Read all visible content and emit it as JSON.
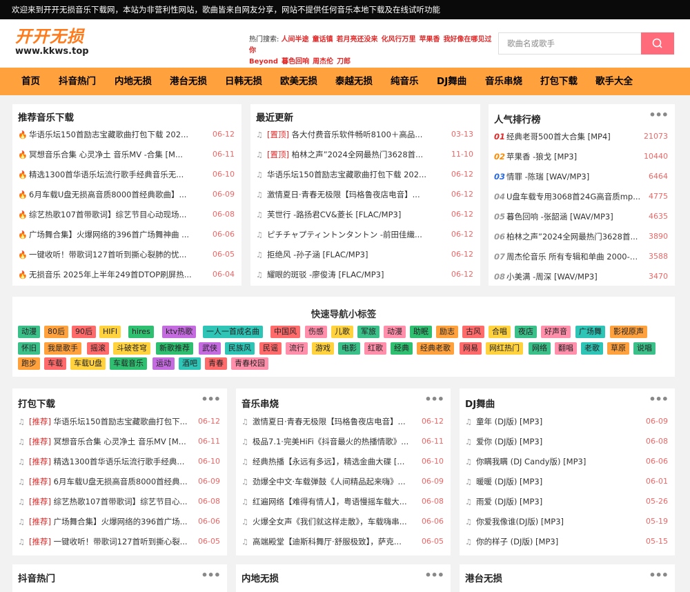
{
  "topbar": {
    "notice": "欢迎来到开开无损音乐下载网，本站为非营利性网站，歌曲皆来自网友分享，网站不提供任何音乐本地下载及在线试听功能"
  },
  "logo": {
    "main": "开开无损",
    "domain": "www.kkws.top"
  },
  "hot": {
    "label": "热门搜索:",
    "items": [
      "人间半途",
      "童话镇",
      "若月亮还没来",
      "化风行万里",
      "苹果香",
      "我好像在哪见过你",
      "Beyond",
      "暮色回响",
      "周杰伦",
      "刀郎"
    ]
  },
  "search": {
    "placeholder": "歌曲名或歌手"
  },
  "nav": [
    "首页",
    "抖音热门",
    "内地无损",
    "港台无损",
    "日韩无损",
    "欧美无损",
    "泰越无损",
    "纯音乐",
    "DJ舞曲",
    "音乐串烧",
    "打包下载",
    "歌手大全"
  ],
  "recommend": {
    "title": "推荐音乐下载",
    "items": [
      {
        "text": "华语乐坛150首励志宝藏歌曲打包下载 202...",
        "date": "06-12"
      },
      {
        "text": "冥想音乐合集 心灵净土 音乐MV -合集 [M...",
        "date": "06-11"
      },
      {
        "text": "精选1300首华语乐坛流行歌手经典音乐无...",
        "date": "06-10"
      },
      {
        "text": "6月车载U盘无损高音质8000首经典歌曲】...",
        "date": "06-09"
      },
      {
        "text": "综艺热歌107首带歌词】综艺节目心动现场...",
        "date": "06-08"
      },
      {
        "text": "广场舞合集】火爆网络的396首广场舞神曲 ...",
        "date": "06-06"
      },
      {
        "text": "一键收听！带歌词127首听到撕心裂肺的忧...",
        "date": "06-05"
      },
      {
        "text": "无损音乐 2025年上半年249首DTOP刷屏热...",
        "date": "06-04"
      }
    ]
  },
  "latest": {
    "title": "最近更新",
    "items": [
      {
        "tag": "[置顶]",
        "text": " 各大付费音乐软件畅听8100＋高品...",
        "date": "03-13"
      },
      {
        "tag": "[置顶]",
        "text": " 柏林之声”2024全网最热门3628首...",
        "date": "11-10"
      },
      {
        "tag": "",
        "text": "华语乐坛150首励志宝藏歌曲打包下载 202...",
        "date": "06-12"
      },
      {
        "tag": "",
        "text": "激情夏日·青春无极限【玛格鲁夜店电音】...",
        "date": "06-12"
      },
      {
        "tag": "",
        "text": "芙世行 -路扬君CV&菱长 [FLAC/MP3]",
        "date": "06-12"
      },
      {
        "tag": "",
        "text": "ピチチャプティントンタントン -前田佳織...",
        "date": "06-12"
      },
      {
        "tag": "",
        "text": "拒绝风 -孙子涵 [FLAC/MP3]",
        "date": "06-12"
      },
      {
        "tag": "",
        "text": "耀眼的斑驳 -廖俊涛 [FLAC/MP3]",
        "date": "06-12"
      }
    ]
  },
  "ranking": {
    "title": "人气排行榜",
    "more": "•••",
    "items": [
      {
        "num": "01",
        "text": "经典老哥500首大合集 [MP4]",
        "count": "21073"
      },
      {
        "num": "02",
        "text": "苹果香 -狼戈 [MP3]",
        "count": "10440"
      },
      {
        "num": "03",
        "text": "情罪 -陈瑞 [WAV/MP3]",
        "count": "6464"
      },
      {
        "num": "04",
        "text": "U盘车载专用3068首24G高音质mp...",
        "count": "4775"
      },
      {
        "num": "05",
        "text": "暮色回响 -张韶涵 [WAV/MP3]",
        "count": "4635"
      },
      {
        "num": "06",
        "text": "柏林之声”2024全网最热门3628首...",
        "count": "3890"
      },
      {
        "num": "07",
        "text": "周杰伦音乐 所有专辑和单曲 2000-2...",
        "count": "3588"
      },
      {
        "num": "08",
        "text": "小美满 -周深 [WAV/MP3]",
        "count": "3470"
      }
    ]
  },
  "quicknav": {
    "title": "快速导航小标签",
    "tags": [
      "动漫",
      "80后",
      "90后",
      "HIFI",
      "hires",
      "ktv热歌",
      "一人一首成名曲",
      "中国风",
      "伤感",
      "儿歌",
      "军旅",
      "动漫",
      "助眠",
      "励志",
      "古风",
      "合唱",
      "夜店",
      "好声音",
      "广场舞",
      "影视原声",
      "怀旧",
      "我是歌手",
      "摇滚",
      "斗破苍穹",
      "新歌推荐",
      "武侠",
      "民族风",
      "民谣",
      "流行",
      "游戏",
      "电影",
      "红歌",
      "经典",
      "经典老歌",
      "网易",
      "网红热门",
      "网络",
      "翻唱",
      "老歌",
      "草原",
      "说唱",
      "跑步",
      "车载",
      "车载U盘",
      "车载音乐",
      "运动",
      "酒吧",
      "青春",
      "青春校园"
    ]
  },
  "pack": {
    "title": "打包下载",
    "more": "•••",
    "items": [
      {
        "tag": "[推荐]",
        "text": " 华语乐坛150首励志宝藏歌曲打包下...",
        "date": "06-12"
      },
      {
        "tag": "[推荐]",
        "text": " 冥想音乐合集 心灵净土 音乐MV [M...",
        "date": "06-11"
      },
      {
        "tag": "[推荐]",
        "text": " 精选1300首华语乐坛流行歌手经典...",
        "date": "06-10"
      },
      {
        "tag": "[推荐]",
        "text": " 6月车载U盘无损高音质8000首经典...",
        "date": "06-09"
      },
      {
        "tag": "[推荐]",
        "text": " 综艺热歌107首带歌词】综艺节目心...",
        "date": "06-08"
      },
      {
        "tag": "[推荐]",
        "text": " 广场舞合集】火爆网络的396首广场...",
        "date": "06-06"
      },
      {
        "tag": "[推荐]",
        "text": " 一键收听！带歌词127首听到撕心裂...",
        "date": "06-05"
      }
    ]
  },
  "medley": {
    "title": "音乐串烧",
    "more": "•••",
    "items": [
      {
        "text": "激情夏日·青春无极限【玛格鲁夜店电音】...",
        "date": "06-12"
      },
      {
        "text": "极品7.1·完美HiFi《抖音最火的热播情歌》...",
        "date": "06-11"
      },
      {
        "text": "经典热播【永远有多远】，精选金曲大碟 [...",
        "date": "06-10"
      },
      {
        "text": "劲爆全中文·车载弹鼓《人间精品起来嗨》...",
        "date": "06-09"
      },
      {
        "text": "红遍网络【难得有情人】，粤语慢摇车载大...",
        "date": "06-08"
      },
      {
        "text": "火爆全女声《我们就这样走散》，车载嗨串...",
        "date": "06-06"
      },
      {
        "text": "高端殿堂【迪斯科舞厅·舒服极致】，萨克...",
        "date": "06-05"
      }
    ]
  },
  "dj": {
    "title": "DJ舞曲",
    "more": "•••",
    "items": [
      {
        "text": "童年 (DJ版) [MP3]",
        "date": "06-09"
      },
      {
        "text": "爱你 (DJ版) [MP3]",
        "date": "06-08"
      },
      {
        "text": "你瞒我瞒 (DJ Candy版) [MP3]",
        "date": "06-06"
      },
      {
        "text": "暖暖 (DJ版) [MP3]",
        "date": "06-01"
      },
      {
        "text": "雨爱 (DJ版) [MP3]",
        "date": "05-26"
      },
      {
        "text": "你爱我像谁(DJ版) [MP3]",
        "date": "05-19"
      },
      {
        "text": "你的样子 (DJ版) [MP3]",
        "date": "05-15"
      }
    ]
  },
  "bottom": [
    {
      "title": "抖音热门",
      "more": "•••"
    },
    {
      "title": "内地无损",
      "more": "•••"
    },
    {
      "title": "港台无损",
      "more": "•••"
    }
  ],
  "colors": {
    "nav": "#ffa23e",
    "accent": "#e02a2a",
    "date": "#e66",
    "search_btn": "#ff6b7a"
  },
  "icons": {
    "fire": "fire-icon",
    "music": "music-note-icon",
    "search": "search-icon"
  }
}
